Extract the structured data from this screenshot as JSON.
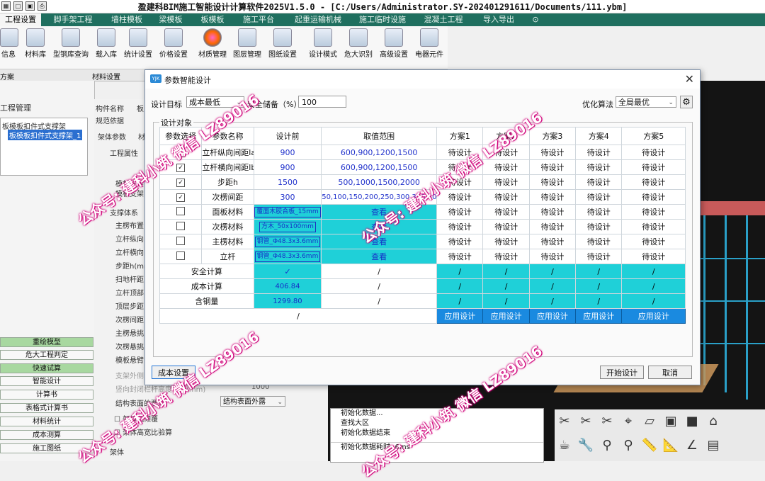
{
  "app": {
    "title": "盈建科BIM施工智能设计计算软件2025V1.5.0 - [C:/Users/Administrator.SY-202401291611/Documents/111.ybm]"
  },
  "menu": [
    "工程设置",
    "脚手架工程",
    "墙柱模板",
    "梁模板",
    "板模板",
    "施工平台",
    "起重运输机械",
    "施工临时设施",
    "混凝土工程",
    "导入导出"
  ],
  "ribbon": {
    "buttons": [
      "信息",
      "材料库",
      "型钢库查询",
      "载入库",
      "统计设置",
      "价格设置",
      "材质管理",
      "图层管理",
      "图纸设置",
      "设计模式",
      "危大识别",
      "高级设置",
      "电器元件"
    ],
    "groups": [
      "方案",
      "材料设置"
    ]
  },
  "left_panel": {
    "title": "工程管理",
    "tree": [
      "板模板扣件式支撑架",
      "板模板扣件式支撑架_1"
    ],
    "buttons": [
      "重绘模型",
      "危大工程判定",
      "快速试算",
      "智能设计",
      "计算书",
      "表格式计算书",
      "材料统计",
      "成本测算",
      "施工图纸"
    ]
  },
  "mid_panel": {
    "rows": [
      "构件名称",
      "规范依据"
    ],
    "tabs": [
      "架体参数",
      "材"
    ],
    "labels": [
      "工程属性",
      "模",
      "模板支架",
      "模板支架",
      "支撑体系",
      "主楞布置",
      "立杆纵向",
      "立杆横向",
      "步距h(mm",
      "扫地杆距",
      "立杆顶部",
      "顶层步距",
      "次楞间距",
      "主楞悬挑",
      "次楞悬挑",
      "模板悬臂",
      "支架外侧",
      "竖向封闭栏杆高度计算(mm)",
      "结构表面的要求",
      "架体抗倾覆",
      "架体高宽比验算",
      "架体"
    ],
    "value": "1000",
    "select": "结构表面外露",
    "name_prefix": "板"
  },
  "log": [
    "初始化数据...",
    "查找大区",
    "初始化数据结束",
    "初始化数据耗时: 6ms"
  ],
  "dialog": {
    "title": "参数智能设计",
    "design_target_label": "设计目标",
    "design_target": "成本最低",
    "safety_label": "安全储备（%）",
    "safety_value": "100",
    "algo_label": "优化算法",
    "algo_value": "全局最优",
    "group_label": "设计对象",
    "headers": [
      "参数选择",
      "参数名称",
      "设计前",
      "取值范围",
      "方案1",
      "方案2",
      "方案3",
      "方案4",
      "方案5"
    ],
    "param_rows": [
      {
        "checked": true,
        "name": "立杆纵向间距la",
        "before": "900",
        "range": "600,900,1200,1500"
      },
      {
        "checked": true,
        "name": "立杆横向间距lb",
        "before": "900",
        "range": "600,900,1200,1500"
      },
      {
        "checked": true,
        "name": "步距h",
        "before": "1500",
        "range": "500,1000,1500,2000"
      },
      {
        "checked": true,
        "name": "次楞间距",
        "before": "300",
        "range": "50,100,150,200,250,300,350,400"
      }
    ],
    "material_rows": [
      {
        "checked": false,
        "name": "面板材料",
        "before": "覆面木胶合板_15mm",
        "range": "查看"
      },
      {
        "checked": false,
        "name": "次楞材料",
        "before": "方木_50x100mm",
        "range": "查看"
      },
      {
        "checked": false,
        "name": "主楞材料",
        "before": "钢管_Φ48.3x3.6mm",
        "range": "查看"
      },
      {
        "checked": false,
        "name": "立杆",
        "before": "钢管_Φ48.3x3.6mm",
        "range": "查看"
      }
    ],
    "pending": "待设计",
    "result_rows": [
      {
        "name": "安全计算",
        "before": "✓"
      },
      {
        "name": "成本计算",
        "before": "406.84"
      },
      {
        "name": "含钢量",
        "before": "1299.80"
      }
    ],
    "slash": "/",
    "apply_label": "应用设计",
    "cost_settings": "成本设置",
    "start": "开始设计",
    "cancel": "取消",
    "close": "✕"
  },
  "watermark": "公众号: 建科小筑 微信 LZ89016"
}
